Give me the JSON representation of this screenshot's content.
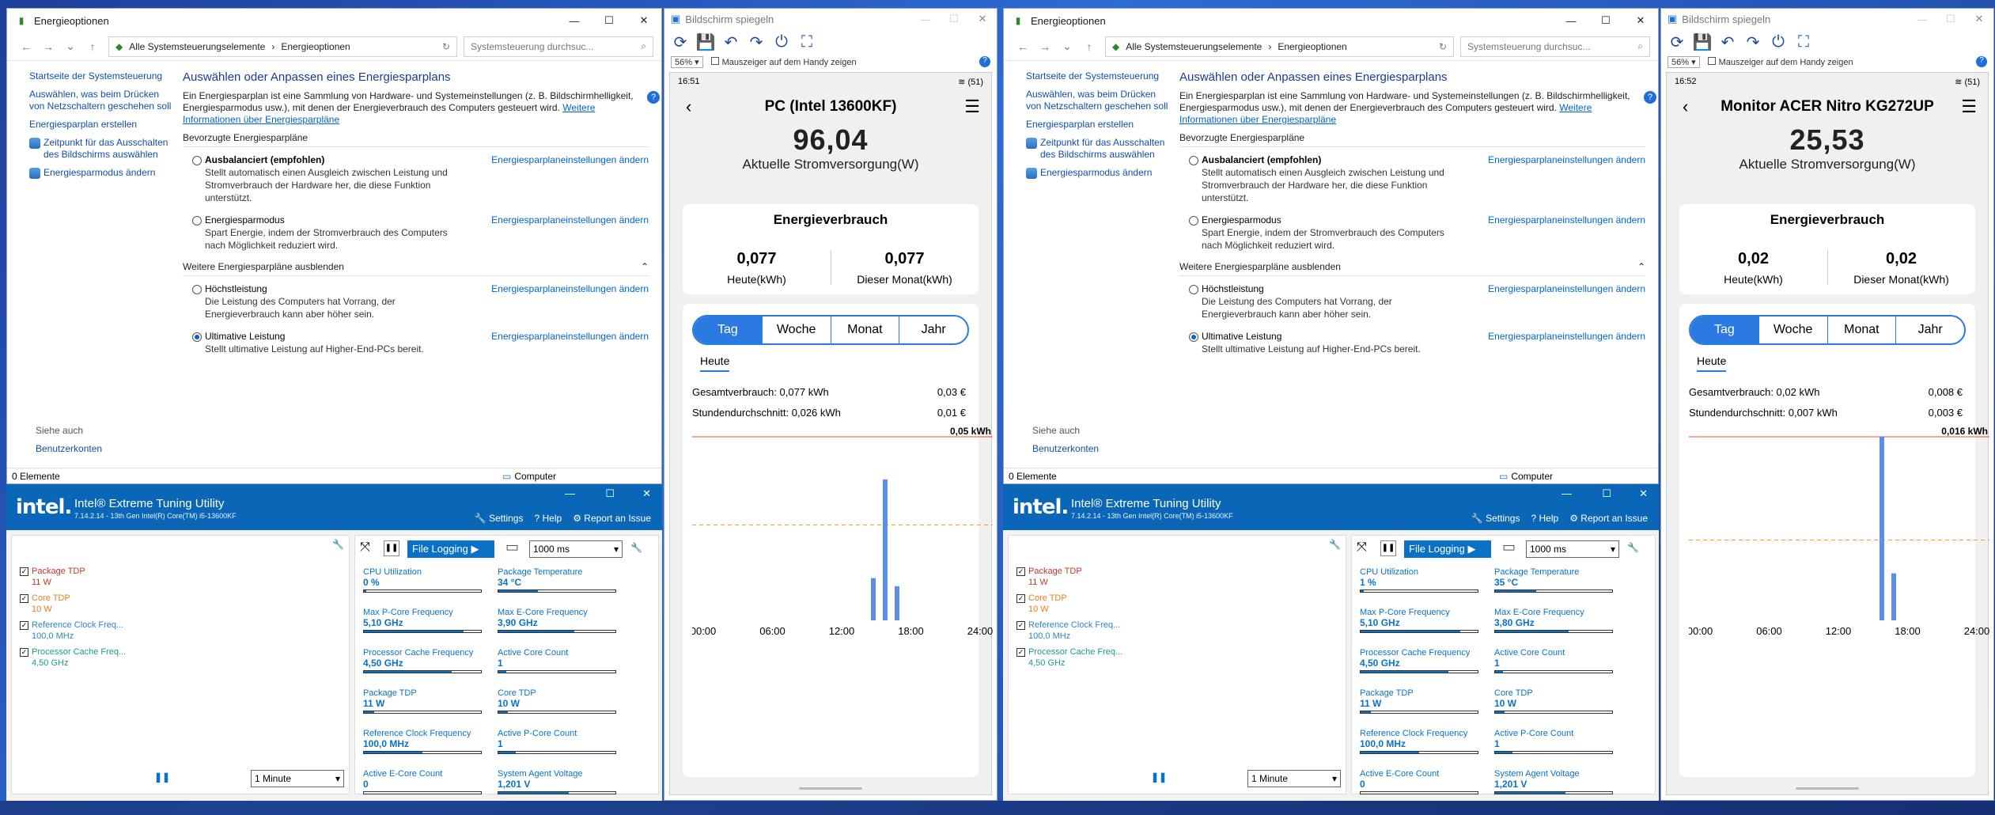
{
  "left": {
    "cp": {
      "title": "Energieoptionen",
      "crumb_root": "Alle Systemsteuerungselemente",
      "crumb_sep": "›",
      "crumb_page": "Energieoptionen",
      "search_placeholder": "Systemsteuerung durchsuc...",
      "sidebar": [
        "Startseite der Systemsteuerung",
        "Auswählen, was beim Drücken von Netzschaltern geschehen soll",
        "Energiesparplan erstellen",
        "Zeitpunkt für das Ausschalten des Bildschirms auswählen",
        "Energiesparmodus ändern"
      ],
      "heading": "Auswählen oder Anpassen eines Energiesparplans",
      "intro": "Ein Energiesparplan ist eine Sammlung von Hardware- und Systemeinstellungen (z. B. Bildschirmhelligkeit, Energiesparmodus usw.), mit denen der Energieverbrauch des Computers gesteuert wird.",
      "intro_link": "Weitere Informationen über Energiesparpläne",
      "preferred": "Bevorzugte Energiesparpläne",
      "more": "Weitere Energiesparpläne ausblenden",
      "change": "Energiesparplaneinstellungen ändern",
      "plans": [
        {
          "name": "Ausbalanciert (empfohlen)",
          "desc": "Stellt automatisch einen Ausgleich zwischen Leistung und Stromverbrauch der Hardware her, die diese Funktion unterstützt."
        },
        {
          "name": "Energiesparmodus",
          "desc": "Spart Energie, indem der Stromverbrauch des Computers nach Möglichkeit reduziert wird."
        },
        {
          "name": "Höchstleistung",
          "desc": "Die Leistung des Computers hat Vorrang, der Energieverbrauch kann aber höher sein."
        },
        {
          "name": "Ultimative Leistung",
          "desc": "Stellt ultimative Leistung auf Higher-End-PCs bereit."
        }
      ],
      "see_also": "Siehe auch",
      "accounts": "Benutzerkonten",
      "status_items": "0 Elemente",
      "status_computer": "Computer"
    },
    "mirror": {
      "title": "Bildschirm spiegeln",
      "zoom": "56%",
      "pointer": "Mauszeiger auf dem Handy zeigen",
      "time": "16:51",
      "status_right": "(51)",
      "device": "PC (Intel 13600KF)",
      "power": "96,04",
      "power_label": "Aktuelle Stromversorgung(W)",
      "energy_title": "Energieverbrauch",
      "today_val": "0,077",
      "today_label": "Heute(kWh)",
      "month_val": "0,077",
      "month_label": "Dieser Monat(kWh)",
      "tabs": [
        "Tag",
        "Woche",
        "Monat",
        "Jahr"
      ],
      "subtab": "Heute",
      "total_label": "Gesamtverbrauch: 0,077 kWh",
      "total_cost": "0,03 €",
      "avg_label": "Stundendurchschnitt: 0,026 kWh",
      "avg_cost": "0,01 €",
      "peak_label": "0,05 kWh"
    },
    "xtu": {
      "title": "Intel® Extreme Tuning Utility",
      "version": "7.14.2.14 - 13th Gen Intel(R) Core(TM) i5-13600KF",
      "settings": "Settings",
      "help": "Help",
      "report": "Report an Issue",
      "legend": [
        {
          "label": "Package TDP",
          "value": "11 W",
          "color": "#c0392b"
        },
        {
          "label": "Core TDP",
          "value": "10 W",
          "color": "#e67e22"
        },
        {
          "label": "Reference Clock Freq...",
          "value": "100,0 MHz",
          "color": "#2e86c1"
        },
        {
          "label": "Processor Cache Freq...",
          "value": "4,50 GHz",
          "color": "#16a085"
        }
      ],
      "interval": "1 Minute",
      "file_logging": "File Logging ▶",
      "log_interval": "1000 ms",
      "metrics": [
        {
          "label": "CPU Utilization",
          "value": "0 %",
          "fill": 0.02
        },
        {
          "label": "Package Temperature",
          "value": "34 °C",
          "fill": 0.34
        },
        {
          "label": "Max P-Core Frequency",
          "value": "5,10 GHz",
          "fill": 0.85
        },
        {
          "label": "Max E-Core Frequency",
          "value": "3,90 GHz",
          "fill": 0.65
        },
        {
          "label": "Processor Cache Frequency",
          "value": "4,50 GHz",
          "fill": 0.75
        },
        {
          "label": "Active Core Count",
          "value": "1",
          "fill": 0.07
        },
        {
          "label": "Package TDP",
          "value": "11 W",
          "fill": 0.09
        },
        {
          "label": "Core TDP",
          "value": "10 W",
          "fill": 0.08
        },
        {
          "label": "Reference Clock Frequency",
          "value": "100,0 MHz",
          "fill": 0.5
        },
        {
          "label": "Active P-Core Count",
          "value": "1",
          "fill": 0.15
        },
        {
          "label": "Active E-Core Count",
          "value": "0",
          "fill": 0.0
        },
        {
          "label": "System Agent Voltage",
          "value": "1,201 V",
          "fill": 0.6
        }
      ]
    },
    "chart_data": {
      "type": "bar",
      "x_ticks": [
        "00:00",
        "06:00",
        "12:00",
        "18:00",
        "24:00"
      ],
      "bars": [
        {
          "hour": 15.0,
          "value": 0.0115
        },
        {
          "hour": 16.0,
          "value": 0.0384
        },
        {
          "hour": 17.0,
          "value": 0.0093
        }
      ],
      "avg_line": 0.026,
      "max": 0.05
    }
  },
  "right": {
    "cp": {
      "title": "Energieoptionen",
      "crumb_root": "Alle Systemsteuerungselemente",
      "crumb_sep": "›",
      "crumb_page": "Energieoptionen",
      "search_placeholder": "Systemsteuerung durchsuc...",
      "sidebar": [
        "Startseite der Systemsteuerung",
        "Auswählen, was beim Drücken von Netzschaltern geschehen soll",
        "Energiesparplan erstellen",
        "Zeitpunkt für das Ausschalten des Bildschirms auswählen",
        "Energiesparmodus ändern"
      ],
      "heading": "Auswählen oder Anpassen eines Energiesparplans",
      "intro": "Ein Energiesparplan ist eine Sammlung von Hardware- und Systemeinstellungen (z. B. Bildschirmhelligkeit, Energiesparmodus usw.), mit denen der Energieverbrauch des Computers gesteuert wird.",
      "intro_link": "Weitere Informationen über Energiesparpläne",
      "preferred": "Bevorzugte Energiesparpläne",
      "more": "Weitere Energiesparpläne ausblenden",
      "change": "Energiesparplaneinstellungen ändern",
      "plans": [
        {
          "name": "Ausbalanciert (empfohlen)",
          "desc": "Stellt automatisch einen Ausgleich zwischen Leistung und Stromverbrauch der Hardware her, die diese Funktion unterstützt."
        },
        {
          "name": "Energiesparmodus",
          "desc": "Spart Energie, indem der Stromverbrauch des Computers nach Möglichkeit reduziert wird."
        },
        {
          "name": "Höchstleistung",
          "desc": "Die Leistung des Computers hat Vorrang, der Energieverbrauch kann aber höher sein."
        },
        {
          "name": "Ultimative Leistung",
          "desc": "Stellt ultimative Leistung auf Higher-End-PCs bereit."
        }
      ],
      "see_also": "Siehe auch",
      "accounts": "Benutzerkonten",
      "status_items": "0 Elemente",
      "status_computer": "Computer"
    },
    "mirror": {
      "title": "Bildschirm spiegeln",
      "zoom": "56%",
      "pointer": "Mauszeiger auf dem Handy zeigen",
      "time": "16:52",
      "status_right": "(51)",
      "device": "Monitor ACER Nitro KG272UP",
      "power": "25,53",
      "power_label": "Aktuelle Stromversorgung(W)",
      "energy_title": "Energieverbrauch",
      "today_val": "0,02",
      "today_label": "Heute(kWh)",
      "month_val": "0,02",
      "month_label": "Dieser Monat(kWh)",
      "tabs": [
        "Tag",
        "Woche",
        "Monat",
        "Jahr"
      ],
      "subtab": "Heute",
      "total_label": "Gesamtverbrauch: 0,02 kWh",
      "total_cost": "0,008 €",
      "avg_label": "Stundendurchschnitt: 0,007 kWh",
      "avg_cost": "0,003 €",
      "peak_label": "0,016 kWh"
    },
    "xtu": {
      "title": "Intel® Extreme Tuning Utility",
      "version": "7.14.2.14 - 13th Gen Intel(R) Core(TM) i5-13600KF",
      "settings": "Settings",
      "help": "Help",
      "report": "Report an Issue",
      "legend": [
        {
          "label": "Package TDP",
          "value": "11 W",
          "color": "#c0392b"
        },
        {
          "label": "Core TDP",
          "value": "10 W",
          "color": "#e67e22"
        },
        {
          "label": "Reference Clock Freq...",
          "value": "100,0 MHz",
          "color": "#2e86c1"
        },
        {
          "label": "Processor Cache Freq...",
          "value": "4,50 GHz",
          "color": "#16a085"
        }
      ],
      "interval": "1 Minute",
      "file_logging": "File Logging ▶",
      "log_interval": "1000 ms",
      "metrics": [
        {
          "label": "CPU Utilization",
          "value": "1 %",
          "fill": 0.03
        },
        {
          "label": "Package Temperature",
          "value": "35 °C",
          "fill": 0.35
        },
        {
          "label": "Max P-Core Frequency",
          "value": "5,10 GHz",
          "fill": 0.85
        },
        {
          "label": "Max E-Core Frequency",
          "value": "3,80 GHz",
          "fill": 0.63
        },
        {
          "label": "Processor Cache Frequency",
          "value": "4,50 GHz",
          "fill": 0.75
        },
        {
          "label": "Active Core Count",
          "value": "1",
          "fill": 0.07
        },
        {
          "label": "Package TDP",
          "value": "11 W",
          "fill": 0.09
        },
        {
          "label": "Core TDP",
          "value": "10 W",
          "fill": 0.08
        },
        {
          "label": "Reference Clock Frequency",
          "value": "100,0 MHz",
          "fill": 0.5
        },
        {
          "label": "Active P-Core Count",
          "value": "1",
          "fill": 0.15
        },
        {
          "label": "Active E-Core Count",
          "value": "0",
          "fill": 0.0
        },
        {
          "label": "System Agent Voltage",
          "value": "1,201 V",
          "fill": 0.6
        }
      ]
    },
    "chart_data": {
      "type": "bar",
      "x_ticks": [
        "00:00",
        "06:00",
        "12:00",
        "18:00",
        "24:00"
      ],
      "bars": [
        {
          "hour": 16.0,
          "value": 0.016
        },
        {
          "hour": 17.0,
          "value": 0.0041
        }
      ],
      "avg_line": 0.007,
      "max": 0.016
    }
  },
  "accent": "#2a7ae2"
}
